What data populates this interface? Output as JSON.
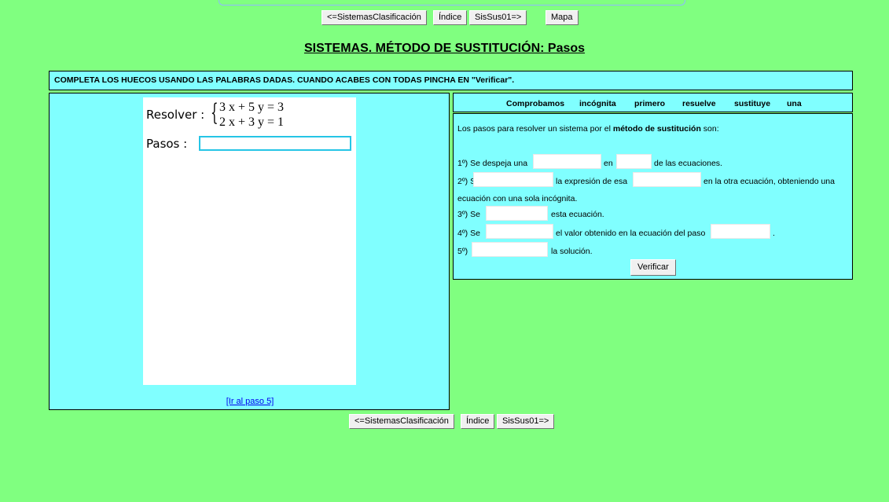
{
  "nav": {
    "prev": "<=SistemasClasificación",
    "index": "Índice",
    "next": "SisSus01=>",
    "map": "Mapa"
  },
  "title": "SISTEMAS. MÉTODO DE SUSTITUCIÓN: Pasos",
  "instruction": "COMPLETA LOS HUECOS USANDO LAS PALABRAS DADAS. CUANDO ACABES CON TODAS PINCHA EN \"Verificar\".",
  "problem": {
    "resolver_label": "Resolver :",
    "eq1": "3 x + 5 y = 3",
    "eq2": "2 x + 3 y = 1",
    "pasos_label": "Pasos :",
    "link": "[Ir al paso 5]"
  },
  "words": [
    "Comprobamos",
    "incógnita",
    "primero",
    "resuelve",
    "sustituye",
    "una"
  ],
  "steps": {
    "intro_pre": "Los pasos para resolver un sistema por el ",
    "intro_bold": "método de sustitución",
    "intro_post": " son:",
    "s1_a": "1º) Se despeja una",
    "s1_b": "en",
    "s1_c": "de las ecuaciones.",
    "s2_a": "2º) Se",
    "s2_b": "la expresión de esa",
    "s2_c": "en la otra ecuación, obteniendo una",
    "s2_d": "ecuación con una sola incógnita.",
    "s3_a": "3º) Se",
    "s3_b": "esta ecuación.",
    "s4_a": "4º) Se",
    "s4_b": "el valor obtenido en la ecuación del paso",
    "s4_c": ".",
    "s5_a": "5º)",
    "s5_b": "la solución.",
    "verify": "Verificar"
  }
}
